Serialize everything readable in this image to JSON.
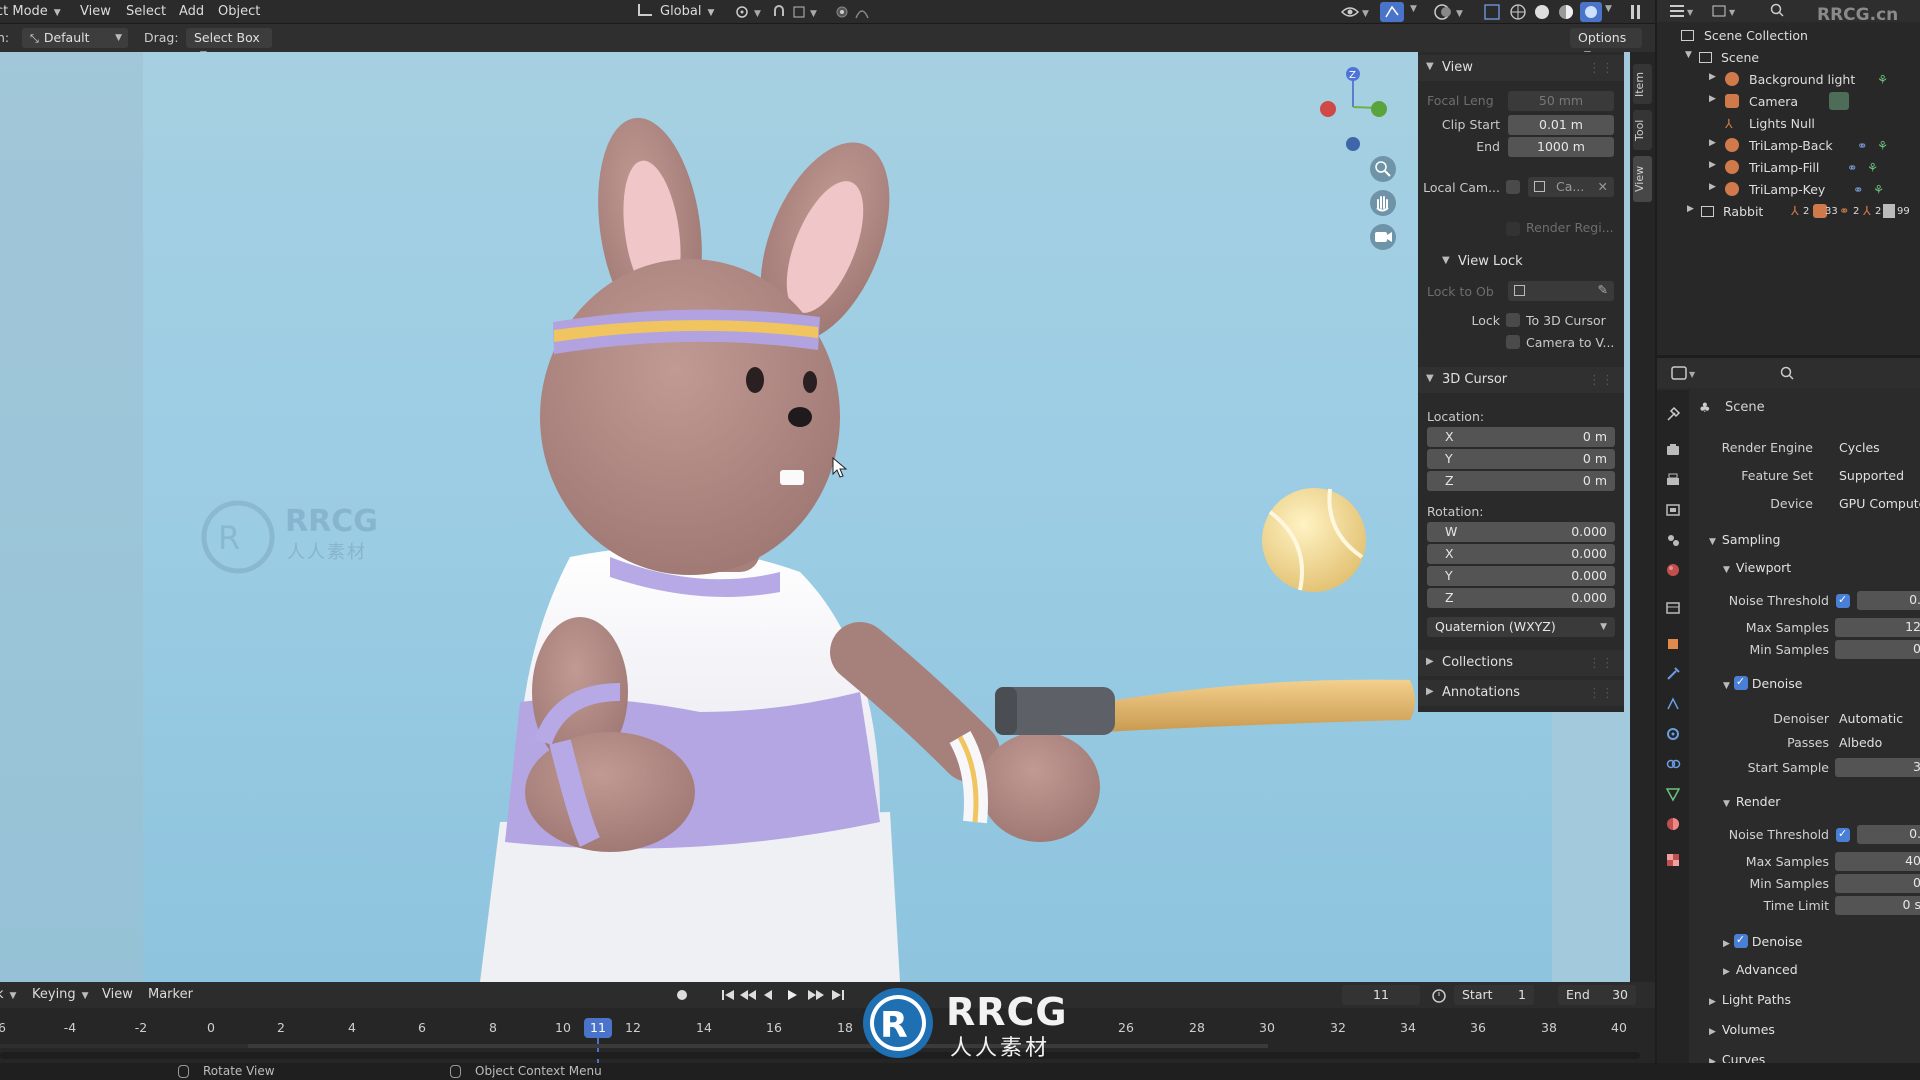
{
  "header": {
    "mode": "ct Mode",
    "menu": [
      "View",
      "Select",
      "Add",
      "Object"
    ],
    "transform_orientation": "Global",
    "orientation_label": "n:",
    "orientation_value": "Default",
    "drag_label": "Drag:",
    "drag_value": "Select Box",
    "options": "Options"
  },
  "side_tabs": [
    "Item",
    "Tool",
    "View"
  ],
  "view_panel": {
    "title": "View",
    "focal_label": "Focal Leng",
    "focal_value": "50 mm",
    "clip_start_label": "Clip Start",
    "clip_start_value": "0.01 m",
    "end_label": "End",
    "end_value": "1000 m",
    "local_cam_label": "Local Cam...",
    "local_cam_value": "Ca...",
    "render_region": "Render Regi...",
    "view_lock_title": "View Lock",
    "lock_to_obj_label": "Lock to Ob",
    "lock_label": "Lock",
    "to_3d_cursor": "To 3D Cursor",
    "camera_to_view": "Camera to V..."
  },
  "cursor_panel": {
    "title": "3D Cursor",
    "location_label": "Location:",
    "loc": [
      {
        "axis": "X",
        "value": "0 m"
      },
      {
        "axis": "Y",
        "value": "0 m"
      },
      {
        "axis": "Z",
        "value": "0 m"
      }
    ],
    "rotation_label": "Rotation:",
    "rot": [
      {
        "axis": "W",
        "value": "0.000"
      },
      {
        "axis": "X",
        "value": "0.000"
      },
      {
        "axis": "Y",
        "value": "0.000"
      },
      {
        "axis": "Z",
        "value": "0.000"
      }
    ],
    "rotation_mode": "Quaternion (WXYZ)",
    "collections": "Collections",
    "annotations": "Annotations"
  },
  "outliner": {
    "scene_collection": "Scene Collection",
    "scene": "Scene",
    "items": [
      "Background light",
      "Camera",
      "Lights Null",
      "TriLamp-Back",
      "TriLamp-Fill",
      "TriLamp-Key",
      "Rabbit"
    ],
    "rabbit_counts": [
      "2",
      "33",
      "2",
      "2",
      "99"
    ]
  },
  "properties": {
    "context": "Scene",
    "render_engine_label": "Render Engine",
    "render_engine": "Cycles",
    "feature_set_label": "Feature Set",
    "feature_set": "Supported",
    "device_label": "Device",
    "device": "GPU Compute",
    "sampling": "Sampling",
    "viewport": "Viewport",
    "noise_threshold": "Noise Threshold",
    "vp_noise_value": "0.",
    "max_samples": "Max Samples",
    "vp_max_value": "12",
    "min_samples": "Min Samples",
    "vp_min_value": "0",
    "denoise": "Denoise",
    "denoiser_label": "Denoiser",
    "denoiser": "Automatic",
    "passes_label": "Passes",
    "passes": "Albedo",
    "start_sample_label": "Start Sample",
    "start_sample": "3",
    "render": "Render",
    "r_noise_value": "0.",
    "r_max_value": "40",
    "r_min_value": "0",
    "time_limit": "Time Limit",
    "time_limit_value": "0 s",
    "advanced": "Advanced",
    "light_paths": "Light Paths",
    "volumes": "Volumes",
    "curves": "Curves"
  },
  "timeline": {
    "menu": [
      "k",
      "Keying",
      "View",
      "Marker"
    ],
    "current_frame": "11",
    "start_label": "Start",
    "start": "1",
    "end_label": "End",
    "end": "30",
    "ticks": [
      "6",
      "-4",
      "-2",
      "0",
      "2",
      "4",
      "6",
      "8",
      "10",
      "11",
      "12",
      "14",
      "16",
      "18",
      "26",
      "28",
      "30",
      "32",
      "34",
      "36",
      "38",
      "40"
    ]
  },
  "status": {
    "rotate": "Rotate View",
    "context_menu": "Object Context Menu"
  },
  "watermark": {
    "brand": "RRCG",
    "cn": "人人素材",
    "corner": "RRCG.cn"
  },
  "colors": {
    "accent": "#4a7fd6",
    "viewport_bg": "#9ccde4",
    "panel_bg": "#2a2a2a"
  }
}
